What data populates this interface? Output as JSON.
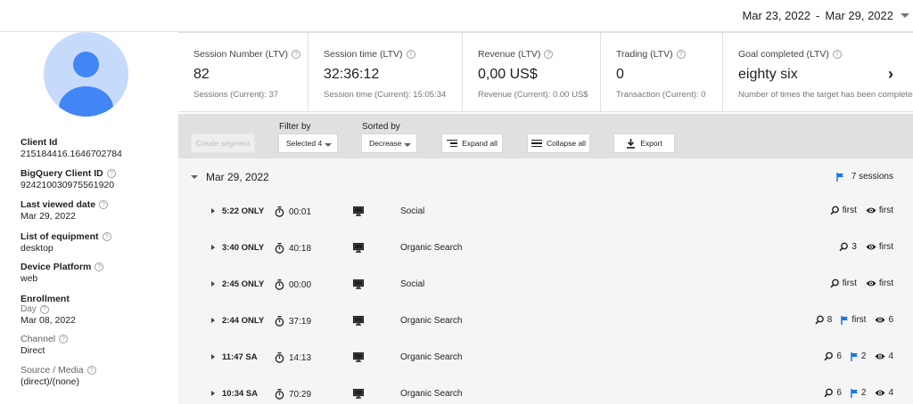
{
  "date_range": {
    "start": "Mar 23, 2022",
    "separator": "-",
    "end": "Mar 29, 2022"
  },
  "client": {
    "fields": [
      {
        "label": "Client Id",
        "value": "215184416.1646702784",
        "help": false
      },
      {
        "label": "BigQuery Client ID",
        "value": "924210030975561920",
        "help": true
      },
      {
        "label": "Last viewed date",
        "value": "Mar 29, 2022",
        "help": true
      },
      {
        "label": "List of equipment",
        "value": "desktop",
        "help": true
      },
      {
        "label": "Device Platform",
        "value": "web",
        "help": true
      },
      {
        "label": "Enrollment",
        "sub": "Day",
        "value": "Mar 08, 2022",
        "help": true
      },
      {
        "label": "Channel",
        "value": "Direct",
        "help": true
      },
      {
        "label": "Source / Media",
        "value": "(direct)/(none)",
        "help": true
      }
    ]
  },
  "metrics": [
    {
      "label": "Session Number (LTV)",
      "value": "82",
      "sub": "Sessions (Current): 37"
    },
    {
      "label": "Session time (LTV)",
      "value": "32:36:12",
      "sub": "Session time (Current): 15:05:34"
    },
    {
      "label": "Revenue (LTV)",
      "value": "0,00 US$",
      "sub": "Revenue (Current): 0.00 US$"
    },
    {
      "label": "Trading (LTV)",
      "value": "0",
      "sub": "Transaction (Current): 0"
    },
    {
      "label": "Goal completed (LTV)",
      "value": "eighty six",
      "sub": "Number of times the target has been completed"
    }
  ],
  "toolbar": {
    "create_segment": "Create segment",
    "filter_label": "Filter by",
    "filter_value": "Selected 4",
    "sort_label": "Sorted by",
    "sort_value": "Decrease",
    "expand_all": "Expand all",
    "collapse_all": "Collapse all",
    "export": "Export"
  },
  "day": {
    "date": "Mar 29, 2022",
    "sessions_label": "7 sessions"
  },
  "sessions": [
    {
      "time": "5:22 ONLY",
      "duration": "00:01",
      "source": "Social",
      "stats": [
        {
          "icon": "search-icon",
          "value": "first"
        },
        {
          "icon": "eye-icon",
          "value": "first"
        }
      ]
    },
    {
      "time": "3:40 ONLY",
      "duration": "40:18",
      "source": "Organic Search",
      "stats": [
        {
          "icon": "search-icon",
          "value": "3"
        },
        {
          "icon": "eye-icon",
          "value": "first"
        }
      ]
    },
    {
      "time": "2:45 ONLY",
      "duration": "00:00",
      "source": "Social",
      "stats": [
        {
          "icon": "search-icon",
          "value": "first"
        },
        {
          "icon": "eye-icon",
          "value": "first"
        }
      ]
    },
    {
      "time": "2:44 ONLY",
      "duration": "37:19",
      "source": "Organic Search",
      "stats": [
        {
          "icon": "search-icon",
          "value": "8"
        },
        {
          "icon": "flag-icon",
          "value": "first"
        },
        {
          "icon": "eye-icon",
          "value": "6"
        }
      ]
    },
    {
      "time": "11:47 SA",
      "duration": "14:13",
      "source": "Organic Search",
      "stats": [
        {
          "icon": "search-icon",
          "value": "6"
        },
        {
          "icon": "flag-icon",
          "value": "2"
        },
        {
          "icon": "eye-icon",
          "value": "4"
        }
      ]
    },
    {
      "time": "10:34 SA",
      "duration": "70:29",
      "source": "Organic Search",
      "stats": [
        {
          "icon": "search-icon",
          "value": "6"
        },
        {
          "icon": "flag-icon",
          "value": "2"
        },
        {
          "icon": "eye-icon",
          "value": "4"
        }
      ]
    }
  ],
  "colors": {
    "accent": "#1a73e8",
    "avatar_bg": "#c6dafc",
    "avatar_fg": "#4285f4",
    "toolbar_bg": "#e0e0e0",
    "list_bg": "#f5f5f5"
  }
}
